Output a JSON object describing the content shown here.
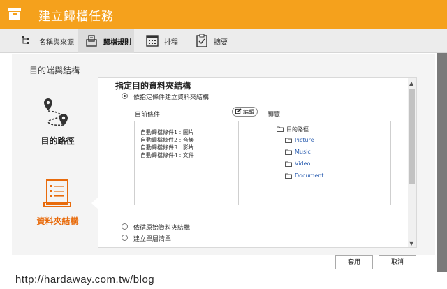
{
  "window": {
    "title": "建立歸檔任務"
  },
  "tabs": [
    {
      "label": "名稱與來源",
      "icon": "source-tree-icon",
      "active": false
    },
    {
      "label": "歸檔規則",
      "icon": "archive-rule-icon",
      "active": true
    },
    {
      "label": "排程",
      "icon": "calendar-icon",
      "active": false
    },
    {
      "label": "摘要",
      "icon": "summary-icon",
      "active": false
    }
  ],
  "left": {
    "section_title": "目的端與結構",
    "nav": [
      {
        "label": "目的路徑",
        "icon": "route-pin-icon"
      },
      {
        "label": "資料夾結構",
        "icon": "folder-structure-icon"
      }
    ]
  },
  "card": {
    "title": "指定目的資料夾結構",
    "option_specified": "依指定條件建立資料夾結構",
    "cond_label": "目前條件",
    "edit_label": "編輯",
    "preview_label": "預覽",
    "conditions": [
      "自動歸檔條件1 : 圖片",
      "自動歸檔條件2 : 音樂",
      "自動歸檔條件3 : 影片",
      "自動歸檔條件4 : 文件"
    ],
    "tree_root": "目的路徑",
    "tree_children": [
      "Picture",
      "Music",
      "Video",
      "Document"
    ],
    "option_original": "依循原始資料夾結構",
    "option_flat": "建立單層清單"
  },
  "buttons": {
    "apply": "套用",
    "cancel": "取消"
  },
  "watermark": "http://hardaway.com.tw/blog",
  "colors": {
    "accent": "#f5a11c",
    "nav_active": "#e86b0c",
    "link": "#2a5db0"
  }
}
